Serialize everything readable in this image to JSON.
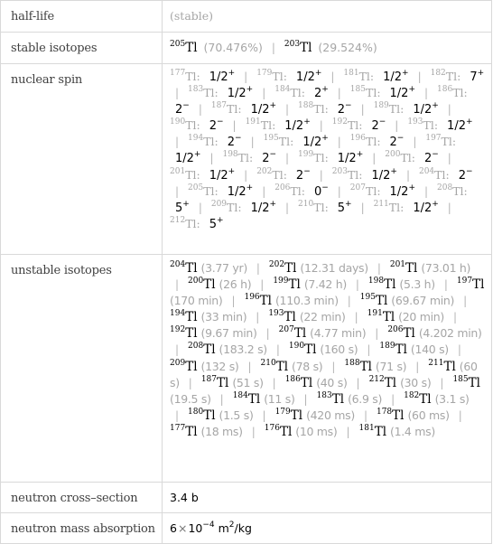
{
  "rows": {
    "half_life": {
      "label": "half-life",
      "value": "(stable)"
    },
    "stable_isotopes": {
      "label": "stable isotopes",
      "items": [
        {
          "mass": "205",
          "symbol": "Tl",
          "abundance": "(70.476%)"
        },
        {
          "mass": "203",
          "symbol": "Tl",
          "abundance": "(29.524%)"
        }
      ]
    },
    "nuclear_spin": {
      "label": "nuclear spin",
      "items": [
        {
          "mass": "177",
          "symbol": "Tl:",
          "spin": "1/2",
          "parity": "+"
        },
        {
          "mass": "179",
          "symbol": "Tl:",
          "spin": "1/2",
          "parity": "+"
        },
        {
          "mass": "181",
          "symbol": "Tl:",
          "spin": "1/2",
          "parity": "+"
        },
        {
          "mass": "182",
          "symbol": "Tl:",
          "spin": "7",
          "parity": "+"
        },
        {
          "mass": "183",
          "symbol": "Tl:",
          "spin": "1/2",
          "parity": "+"
        },
        {
          "mass": "184",
          "symbol": "Tl:",
          "spin": "2",
          "parity": "+"
        },
        {
          "mass": "185",
          "symbol": "Tl:",
          "spin": "1/2",
          "parity": "+"
        },
        {
          "mass": "186",
          "symbol": "Tl:",
          "spin": "2",
          "parity": "−"
        },
        {
          "mass": "187",
          "symbol": "Tl:",
          "spin": "1/2",
          "parity": "+"
        },
        {
          "mass": "188",
          "symbol": "Tl:",
          "spin": "2",
          "parity": "−"
        },
        {
          "mass": "189",
          "symbol": "Tl:",
          "spin": "1/2",
          "parity": "+"
        },
        {
          "mass": "190",
          "symbol": "Tl:",
          "spin": "2",
          "parity": "−"
        },
        {
          "mass": "191",
          "symbol": "Tl:",
          "spin": "1/2",
          "parity": "+"
        },
        {
          "mass": "192",
          "symbol": "Tl:",
          "spin": "2",
          "parity": "−"
        },
        {
          "mass": "193",
          "symbol": "Tl:",
          "spin": "1/2",
          "parity": "+"
        },
        {
          "mass": "194",
          "symbol": "Tl:",
          "spin": "2",
          "parity": "−"
        },
        {
          "mass": "195",
          "symbol": "Tl:",
          "spin": "1/2",
          "parity": "+"
        },
        {
          "mass": "196",
          "symbol": "Tl:",
          "spin": "2",
          "parity": "−"
        },
        {
          "mass": "197",
          "symbol": "Tl:",
          "spin": "1/2",
          "parity": "+"
        },
        {
          "mass": "198",
          "symbol": "Tl:",
          "spin": "2",
          "parity": "−"
        },
        {
          "mass": "199",
          "symbol": "Tl:",
          "spin": "1/2",
          "parity": "+"
        },
        {
          "mass": "200",
          "symbol": "Tl:",
          "spin": "2",
          "parity": "−"
        },
        {
          "mass": "201",
          "symbol": "Tl:",
          "spin": "1/2",
          "parity": "+"
        },
        {
          "mass": "202",
          "symbol": "Tl:",
          "spin": "2",
          "parity": "−"
        },
        {
          "mass": "203",
          "symbol": "Tl:",
          "spin": "1/2",
          "parity": "+"
        },
        {
          "mass": "204",
          "symbol": "Tl:",
          "spin": "2",
          "parity": "−"
        },
        {
          "mass": "205",
          "symbol": "Tl:",
          "spin": "1/2",
          "parity": "+"
        },
        {
          "mass": "206",
          "symbol": "Tl:",
          "spin": "0",
          "parity": "−"
        },
        {
          "mass": "207",
          "symbol": "Tl:",
          "spin": "1/2",
          "parity": "+"
        },
        {
          "mass": "208",
          "symbol": "Tl:",
          "spin": "5",
          "parity": "+"
        },
        {
          "mass": "209",
          "symbol": "Tl:",
          "spin": "1/2",
          "parity": "+"
        },
        {
          "mass": "210",
          "symbol": "Tl:",
          "spin": "5",
          "parity": "+"
        },
        {
          "mass": "211",
          "symbol": "Tl:",
          "spin": "1/2",
          "parity": "+"
        },
        {
          "mass": "212",
          "symbol": "Tl:",
          "spin": "5",
          "parity": "+"
        }
      ]
    },
    "unstable_isotopes": {
      "label": "unstable isotopes",
      "items": [
        {
          "mass": "204",
          "symbol": "Tl",
          "half_life": "(3.77 yr)"
        },
        {
          "mass": "202",
          "symbol": "Tl",
          "half_life": "(12.31 days)"
        },
        {
          "mass": "201",
          "symbol": "Tl",
          "half_life": "(73.01 h)"
        },
        {
          "mass": "200",
          "symbol": "Tl",
          "half_life": "(26 h)"
        },
        {
          "mass": "199",
          "symbol": "Tl",
          "half_life": "(7.42 h)"
        },
        {
          "mass": "198",
          "symbol": "Tl",
          "half_life": "(5.3 h)"
        },
        {
          "mass": "197",
          "symbol": "Tl",
          "half_life": "(170 min)"
        },
        {
          "mass": "196",
          "symbol": "Tl",
          "half_life": "(110.3 min)"
        },
        {
          "mass": "195",
          "symbol": "Tl",
          "half_life": "(69.67 min)"
        },
        {
          "mass": "194",
          "symbol": "Tl",
          "half_life": "(33 min)"
        },
        {
          "mass": "193",
          "symbol": "Tl",
          "half_life": "(22 min)"
        },
        {
          "mass": "191",
          "symbol": "Tl",
          "half_life": "(20 min)"
        },
        {
          "mass": "192",
          "symbol": "Tl",
          "half_life": "(9.67 min)"
        },
        {
          "mass": "207",
          "symbol": "Tl",
          "half_life": "(4.77 min)"
        },
        {
          "mass": "206",
          "symbol": "Tl",
          "half_life": "(4.202 min)"
        },
        {
          "mass": "208",
          "symbol": "Tl",
          "half_life": "(183.2 s)"
        },
        {
          "mass": "190",
          "symbol": "Tl",
          "half_life": "(160 s)"
        },
        {
          "mass": "189",
          "symbol": "Tl",
          "half_life": "(140 s)"
        },
        {
          "mass": "209",
          "symbol": "Tl",
          "half_life": "(132 s)"
        },
        {
          "mass": "210",
          "symbol": "Tl",
          "half_life": "(78 s)"
        },
        {
          "mass": "188",
          "symbol": "Tl",
          "half_life": "(71 s)"
        },
        {
          "mass": "211",
          "symbol": "Tl",
          "half_life": "(60 s)"
        },
        {
          "mass": "187",
          "symbol": "Tl",
          "half_life": "(51 s)"
        },
        {
          "mass": "186",
          "symbol": "Tl",
          "half_life": "(40 s)"
        },
        {
          "mass": "212",
          "symbol": "Tl",
          "half_life": "(30 s)"
        },
        {
          "mass": "185",
          "symbol": "Tl",
          "half_life": "(19.5 s)"
        },
        {
          "mass": "184",
          "symbol": "Tl",
          "half_life": "(11 s)"
        },
        {
          "mass": "183",
          "symbol": "Tl",
          "half_life": "(6.9 s)"
        },
        {
          "mass": "182",
          "symbol": "Tl",
          "half_life": "(3.1 s)"
        },
        {
          "mass": "180",
          "symbol": "Tl",
          "half_life": "(1.5 s)"
        },
        {
          "mass": "179",
          "symbol": "Tl",
          "half_life": "(420 ms)"
        },
        {
          "mass": "178",
          "symbol": "Tl",
          "half_life": "(60 ms)"
        },
        {
          "mass": "177",
          "symbol": "Tl",
          "half_life": "(18 ms)"
        },
        {
          "mass": "176",
          "symbol": "Tl",
          "half_life": "(10 ms)"
        },
        {
          "mass": "181",
          "symbol": "Tl",
          "half_life": "(1.4 ms)"
        }
      ]
    },
    "neutron_cross_section": {
      "label": "neutron cross–section",
      "value": "3.4 b"
    },
    "neutron_mass_absorption": {
      "label": "neutron mass absorption",
      "mantissa": "6",
      "times": "×",
      "base": "10",
      "exponent": "−4",
      "unit": "m",
      "unit_exp": "2",
      "unit_rest": "/kg"
    }
  },
  "separator": "|"
}
